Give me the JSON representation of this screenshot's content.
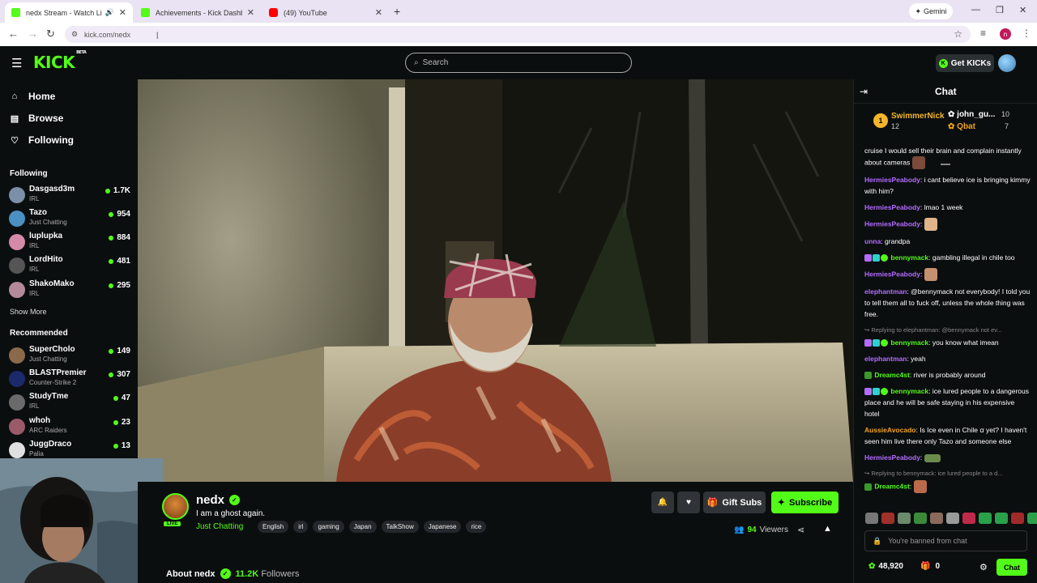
{
  "browser": {
    "tabs": [
      {
        "title": "nedx Stream - Watch Live o...",
        "active": true
      },
      {
        "title": "Achievements - Kick Dashboard",
        "active": false
      },
      {
        "title": "(49) YouTube",
        "active": false
      }
    ],
    "gemini_label": "Gemini",
    "url": "kick.com/nedx"
  },
  "header": {
    "logo": "KICK",
    "logo_tag": "BETA",
    "search_placeholder": "Search",
    "get_kicks": "Get KICKs"
  },
  "sidebar": {
    "nav": [
      {
        "label": "Home",
        "icon": "home-icon"
      },
      {
        "label": "Browse",
        "icon": "browse-icon"
      },
      {
        "label": "Following",
        "icon": "heart-icon"
      }
    ],
    "following_title": "Following",
    "following": [
      {
        "name": "Dasgasd3m",
        "category": "IRL",
        "viewers": "1.7K"
      },
      {
        "name": "Tazo",
        "category": "Just Chatting",
        "viewers": "954"
      },
      {
        "name": "luplupka",
        "category": "IRL",
        "viewers": "884"
      },
      {
        "name": "LordHito",
        "category": "IRL",
        "viewers": "481"
      },
      {
        "name": "ShakoMako",
        "category": "IRL",
        "viewers": "295"
      }
    ],
    "show_more": "Show More",
    "recommended_title": "Recommended",
    "recommended": [
      {
        "name": "SuperCholo",
        "category": "Just Chatting",
        "viewers": "149"
      },
      {
        "name": "BLASTPremier",
        "category": "Counter-Strike 2",
        "viewers": "307"
      },
      {
        "name": "StudyTme",
        "category": "IRL",
        "viewers": "47"
      },
      {
        "name": "whoh",
        "category": "ARC Raiders",
        "viewers": "23"
      },
      {
        "name": "JuggDraco",
        "category": "Palia",
        "viewers": "13"
      }
    ]
  },
  "stream": {
    "channel": "nedx",
    "live_label": "LIVE",
    "title": "I am a ghost again.",
    "category": "Just Chatting",
    "tags": [
      "English",
      "irl",
      "gaming",
      "Japan",
      "TalkShow",
      "Japanese",
      "rice"
    ],
    "gift_subs": "Gift Subs",
    "subscribe": "Subscribe",
    "viewers": "94",
    "viewers_label": "Viewers",
    "about_label": "About nedx",
    "followers": "11.2K",
    "followers_label": "Followers"
  },
  "chat": {
    "title": "Chat",
    "leaderboard": [
      {
        "rank": "1",
        "name": "SwimmerNick",
        "count": "12",
        "color": "#f3b62b"
      },
      {
        "name": "john_gu...",
        "count": "10",
        "color": "#ffffff"
      },
      {
        "name": "Qbat",
        "count": "7",
        "color": "#f3a31b"
      }
    ],
    "messages": [
      {
        "user": "",
        "text": "cruise I would sell their brain and complain instantly about cameras",
        "color": "#fff",
        "emote": "#7a4a3a"
      },
      {
        "user": "HermiesPeabody",
        "text": "i cant believe ice is bringing kimmy with him?",
        "color": "#b36cff"
      },
      {
        "user": "HermiesPeabody",
        "text": "lmao 1 week",
        "color": "#b36cff"
      },
      {
        "user": "HermiesPeabody",
        "text": "",
        "color": "#b36cff",
        "emote": "#e0b48a"
      },
      {
        "user": "unna",
        "text": "grandpa",
        "color": "#b36cff"
      },
      {
        "user": "bennymack",
        "text": "gambling illegal in chile too",
        "color": "#53fc18",
        "badges": true
      },
      {
        "user": "HermiesPeabody",
        "text": "",
        "color": "#b36cff",
        "emote": "#c59070"
      },
      {
        "user": "elephantman",
        "text": "@bennymack not everybody! I told you to tell them all to fuck off, unless the whole thing was free.",
        "color": "#b36cff"
      },
      {
        "reply": "Replying to elephantman: @bennymack not ev...",
        "user": "bennymack",
        "text": "you know what imean",
        "color": "#53fc18",
        "badges": true
      },
      {
        "user": "elephantman",
        "text": "yeah",
        "color": "#b36cff"
      },
      {
        "user": "Dreamc4st",
        "text": "river is probably around",
        "color": "#53fc18",
        "leaf": true
      },
      {
        "user": "bennymack",
        "text": "ice lured people to a dangerous place and he will be safe staying in his expensive hotel",
        "color": "#53fc18",
        "badges": true
      },
      {
        "user": "AussieAvocado",
        "text": "Is Ice even in Chile ꭤ yet? I haven't seen him live there only Tazo and someone else",
        "color": "#f3a31b"
      },
      {
        "user": "HermiesPeabody",
        "text": "",
        "color": "#b36cff",
        "emote": "#6a8a4a"
      },
      {
        "reply": "Replying to bennymack: ice lured people to a d...",
        "user": "Dreamc4st",
        "text": "",
        "color": "#53fc18",
        "leaf": true,
        "emote": "#b86a4a"
      }
    ],
    "banned": "You're banned from chat",
    "points": "48,920",
    "gifts": "0",
    "chat_button": "Chat"
  }
}
